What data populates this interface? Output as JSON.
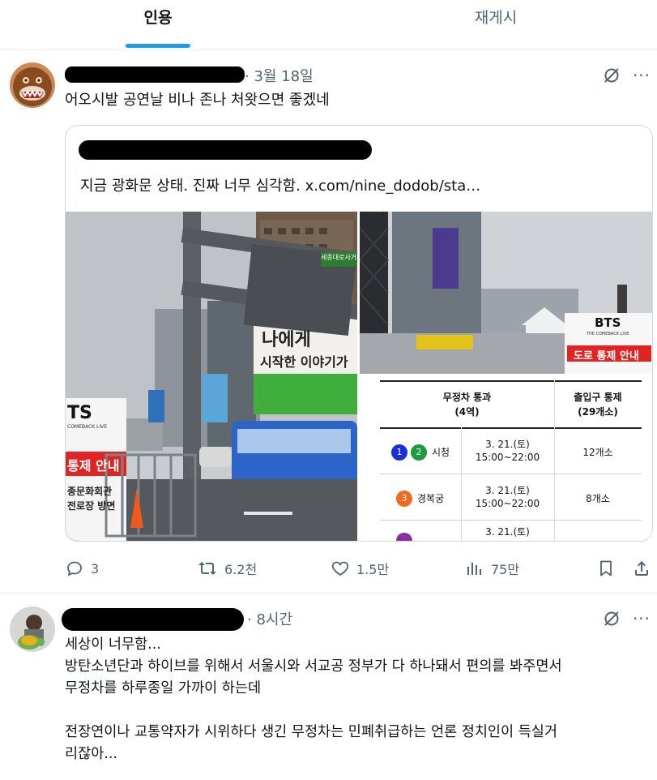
{
  "tabs": [
    {
      "label": "인용",
      "selected": true
    },
    {
      "label": "재게시",
      "selected": false
    }
  ],
  "colors": {
    "accent": "#1d9bf0",
    "muted": "#536471",
    "text": "#0f1419",
    "border": "#cfd9de"
  },
  "post1": {
    "timestamp": "· 3월 18일",
    "text": "어오시발 공연날 비나 존나 처왓으면 좋겠네",
    "quote": {
      "text": "지금 광화문 상태. 진짜 너무 심각함.  x.com/nine_dodob/sta…",
      "image_left": {
        "sign_street": "세종대로사거리",
        "billboard_line1": "나에게",
        "billboard_line2": "시작한 이야기가",
        "banner_brand": "TS",
        "banner_sub": "COMEBACK LIVE",
        "banner_notice": "통제 안내",
        "banner_line1": "종문화회관",
        "banner_line2": "전로장 방면"
      },
      "image_right": {
        "banner_brand": "BTS",
        "banner_sub": "THE COMEBACK LIVE",
        "banner_notice": "도로 통제 안내",
        "table": {
          "headers": [
            "무정차 통과\n(4역)",
            "출입구 통제\n(29개소)"
          ],
          "rows": [
            {
              "lines": [
                "1",
                "2"
              ],
              "line_colors": [
                "#1a2fd6",
                "#1f9a3c"
              ],
              "station": "시청",
              "date": "3. 21.(토)",
              "time": "15:00~22:00",
              "exits": "12개소"
            },
            {
              "lines": [
                "3"
              ],
              "line_colors": [
                "#f26a1e"
              ],
              "station": "경복궁",
              "date": "3. 21.(토)",
              "time": "15:00~22:00",
              "exits": "8개소"
            },
            {
              "lines": [
                ""
              ],
              "line_colors": [
                "#8b2b9e"
              ],
              "station": "",
              "date": "3. 21.(토)",
              "time": "",
              "exits": ""
            }
          ]
        }
      }
    },
    "actions": {
      "replies": "3",
      "reposts": "6.2천",
      "likes": "1.5만",
      "views": "75만"
    }
  },
  "post2": {
    "timestamp": "· 8시간",
    "text": "세상이 너무함...\n방탄소년단과 하이브를 위해서 서울시와 서교공 정부가 다 하나돼서 편의를 봐주면서\n무정차를 하루종일 가까이 하는데\n\n전장연이나 교통약자가 시위하다 생긴 무정차는 민폐취급하는 언론 정치인이 득실거\n리잖아..."
  }
}
